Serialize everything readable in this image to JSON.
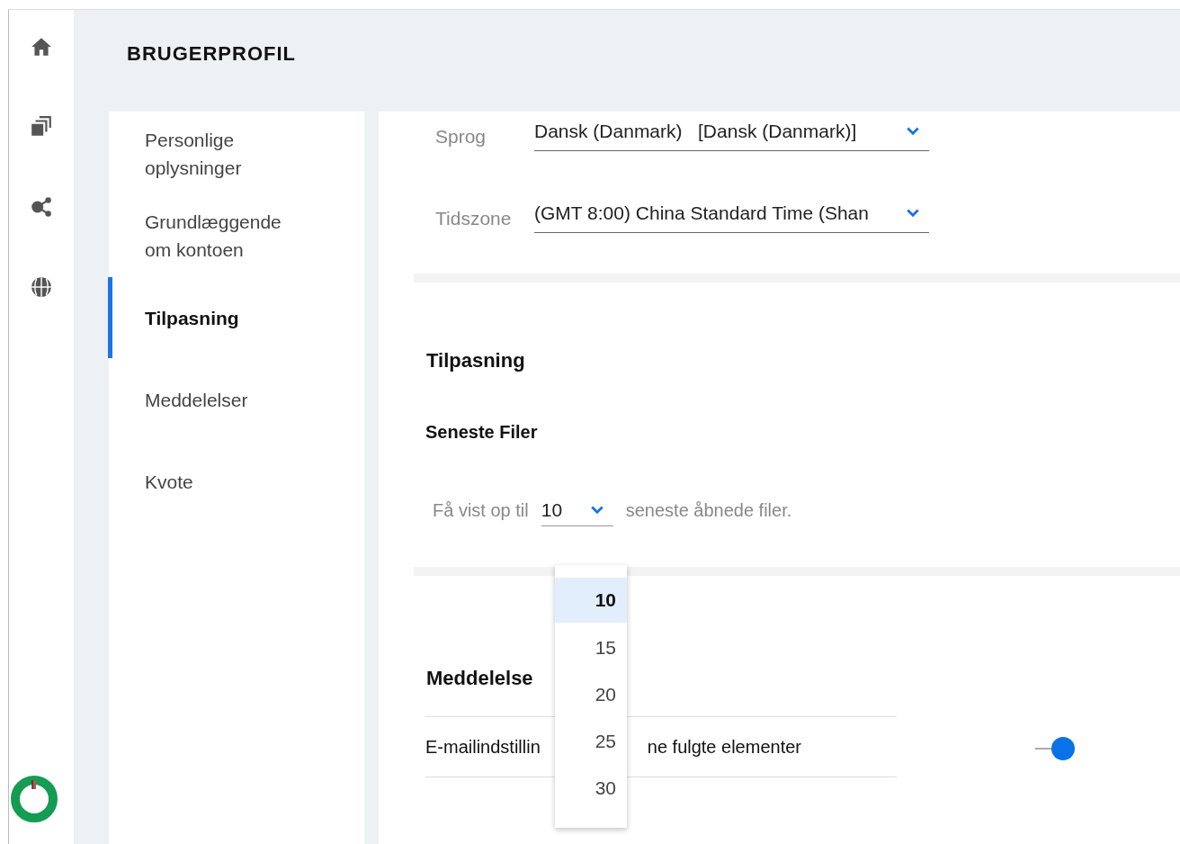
{
  "page_title": "BRUGERPROFIL",
  "nav": {
    "items": [
      {
        "label": "Personlige oplysninger",
        "selected": false
      },
      {
        "label": "Grundlæggende om kontoen",
        "selected": false
      },
      {
        "label": "Tilpasning",
        "selected": true
      },
      {
        "label": "Meddelelser",
        "selected": false
      },
      {
        "label": "Kvote",
        "selected": false
      }
    ]
  },
  "language": {
    "label": "Sprog",
    "value": "Dansk (Danmark)   [Dansk (Danmark)]"
  },
  "timezone": {
    "label": "Tidszone",
    "value": "(GMT 8:00) China Standard Time (Shan"
  },
  "customization": {
    "title": "Tilpasning",
    "subtitle": "Seneste Filer",
    "prefix": "Få vist op til",
    "select_value": "10",
    "suffix": "seneste åbnede filer.",
    "expanded": true,
    "options": [
      {
        "label": "10",
        "selected": true
      },
      {
        "label": "15",
        "selected": false
      },
      {
        "label": "20",
        "selected": false
      },
      {
        "label": "25",
        "selected": false
      },
      {
        "label": "30",
        "selected": false
      }
    ]
  },
  "notifications": {
    "title": "Meddelelse",
    "rows": [
      {
        "label_start": "E-mailindstillin",
        "label_end": "ne fulgte elementer",
        "on": true
      }
    ]
  }
}
